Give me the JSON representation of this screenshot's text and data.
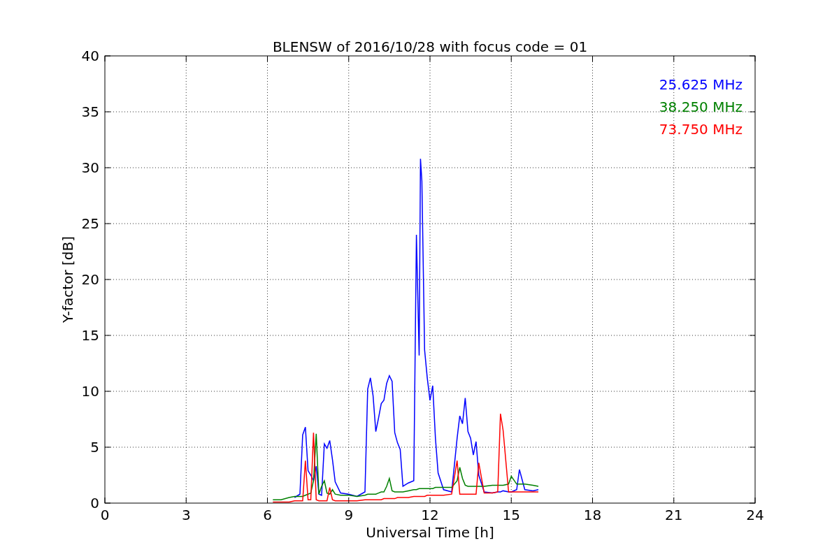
{
  "chart_data": {
    "type": "line",
    "grid": true,
    "title": "BLENSW of 2016/10/28 with focus code = 01",
    "xlabel": "Universal Time [h]",
    "ylabel": "Y-factor [dB]",
    "xlim": [
      0,
      24
    ],
    "ylim": [
      0,
      40
    ],
    "xticks": [
      0,
      3,
      6,
      9,
      12,
      15,
      18,
      21,
      24
    ],
    "yticks": [
      0,
      5,
      10,
      15,
      20,
      25,
      30,
      35,
      40
    ],
    "x": [
      6.2,
      6.5,
      6.8,
      7.0,
      7.2,
      7.3,
      7.4,
      7.5,
      7.6,
      7.7,
      7.8,
      7.9,
      8.0,
      8.1,
      8.2,
      8.3,
      8.4,
      8.5,
      8.7,
      9.0,
      9.3,
      9.6,
      9.7,
      9.8,
      9.9,
      10.0,
      10.1,
      10.2,
      10.3,
      10.4,
      10.5,
      10.6,
      10.7,
      10.8,
      10.9,
      11.0,
      11.2,
      11.4,
      11.5,
      11.6,
      11.65,
      11.7,
      11.8,
      11.9,
      12.0,
      12.1,
      12.2,
      12.3,
      12.5,
      12.8,
      13.0,
      13.1,
      13.2,
      13.3,
      13.4,
      13.5,
      13.6,
      13.7,
      13.8,
      14.0,
      14.3,
      14.5,
      14.6,
      14.7,
      14.9,
      15.0,
      15.2,
      15.3,
      15.5,
      15.8,
      16.0
    ],
    "series": [
      {
        "name": "25.625 MHz",
        "color": "#0000ff",
        "values": [
          null,
          null,
          null,
          0.5,
          0.8,
          6.1,
          6.8,
          2.9,
          2.5,
          2.0,
          3.3,
          0.8,
          0.7,
          5.3,
          4.9,
          5.6,
          3.9,
          1.9,
          0.9,
          0.8,
          0.6,
          1.0,
          10.2,
          11.2,
          9.6,
          6.4,
          7.6,
          8.9,
          9.2,
          10.7,
          11.4,
          10.9,
          6.3,
          5.4,
          4.8,
          1.5,
          1.8,
          2.0,
          24.0,
          13.2,
          30.8,
          28.8,
          13.7,
          11.2,
          9.2,
          10.5,
          5.8,
          2.7,
          1.2,
          1.0,
          5.8,
          7.8,
          7.1,
          9.4,
          6.4,
          5.8,
          4.3,
          5.5,
          2.5,
          1.0,
          0.9,
          1.0,
          1.0,
          1.1,
          1.0,
          1.0,
          1.2,
          3.0,
          1.2,
          1.1,
          1.2
        ]
      },
      {
        "name": "38.250 MHz",
        "color": "#008000",
        "values": [
          0.3,
          0.3,
          0.5,
          0.6,
          0.6,
          0.6,
          0.7,
          0.8,
          0.9,
          2.0,
          6.2,
          0.8,
          1.5,
          2.0,
          0.9,
          0.8,
          1.2,
          0.8,
          0.7,
          0.7,
          0.6,
          0.7,
          0.8,
          0.8,
          0.8,
          0.8,
          0.9,
          1.0,
          1.0,
          1.5,
          2.2,
          1.1,
          1.0,
          1.0,
          1.0,
          1.0,
          1.1,
          1.2,
          1.2,
          1.3,
          1.3,
          1.3,
          1.3,
          1.3,
          1.3,
          1.3,
          1.4,
          1.4,
          1.4,
          1.4,
          2.0,
          3.2,
          2.2,
          1.6,
          1.5,
          1.5,
          1.5,
          1.5,
          1.5,
          1.5,
          1.6,
          1.6,
          1.6,
          1.6,
          1.7,
          2.4,
          1.7,
          1.7,
          1.7,
          1.6,
          1.5
        ]
      },
      {
        "name": "73.750 MHz",
        "color": "#ff0000",
        "values": [
          0.1,
          0.1,
          0.1,
          0.2,
          0.2,
          0.2,
          3.8,
          0.3,
          0.3,
          6.3,
          0.3,
          0.2,
          0.2,
          0.2,
          0.2,
          1.4,
          0.3,
          0.2,
          0.2,
          0.2,
          0.2,
          0.3,
          0.3,
          0.3,
          0.3,
          0.3,
          0.3,
          0.3,
          0.4,
          0.4,
          0.4,
          0.4,
          0.4,
          0.5,
          0.5,
          0.5,
          0.5,
          0.6,
          0.6,
          0.6,
          0.6,
          0.6,
          0.6,
          0.7,
          0.7,
          0.7,
          0.7,
          0.7,
          0.7,
          0.8,
          3.8,
          0.8,
          0.8,
          0.8,
          0.8,
          0.8,
          0.8,
          0.8,
          3.6,
          0.9,
          0.9,
          1.0,
          8.0,
          6.5,
          1.0,
          1.0,
          1.0,
          1.0,
          1.0,
          1.0,
          1.0
        ]
      }
    ]
  }
}
